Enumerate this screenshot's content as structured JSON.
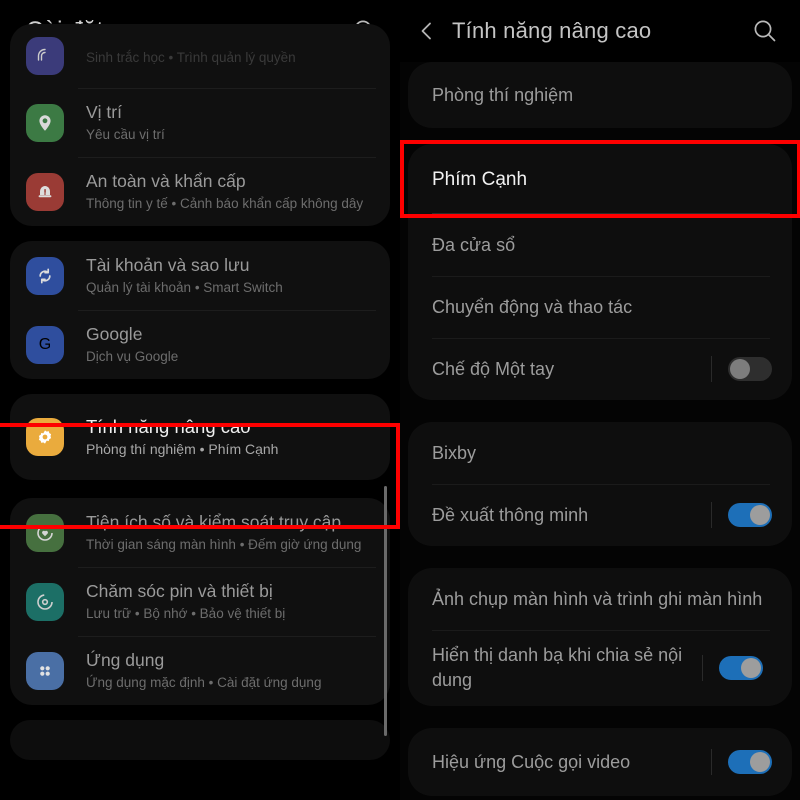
{
  "left_panel": {
    "header": {
      "title": "Cài đặt",
      "search_icon": "search-icon"
    },
    "cards": [
      {
        "rows": [
          {
            "title": "",
            "subtitle": "Sinh trắc học  •  Trình quản lý quyền",
            "icon": "fingerprint-icon",
            "icon_color": "#3b3b7a",
            "state": "faded"
          },
          {
            "title": "Vị trí",
            "subtitle": "Yêu cầu vị trí",
            "icon": "location-pin-icon",
            "icon_color": "#3c7a44",
            "state": "normal"
          },
          {
            "title": "An toàn và khẩn cấp",
            "subtitle": "Thông tin y tế  •  Cảnh báo khẩn cấp không dây",
            "icon": "emergency-alert-icon",
            "icon_color": "#9a3b35",
            "state": "normal"
          }
        ]
      },
      {
        "rows": [
          {
            "title": "Tài khoản và sao lưu",
            "subtitle": "Quản lý tài khoản  •  Smart Switch",
            "icon": "sync-accounts-icon",
            "icon_color": "#2f4e9e",
            "state": "normal"
          },
          {
            "title": "Google",
            "subtitle": "Dịch vụ Google",
            "icon": "google-g-icon",
            "icon_color": "#2f4e9e",
            "state": "normal"
          }
        ]
      },
      {
        "rows": [
          {
            "title": "Tính năng nâng cao",
            "subtitle": "Phòng thí nghiệm  •  Phím Cạnh",
            "icon": "advanced-gear-icon",
            "icon_color": "#eaab3d",
            "state": "selected"
          }
        ]
      },
      {
        "rows": [
          {
            "title": "Tiện ích số và kiểm soát truy cập",
            "subtitle": "Thời gian sáng màn hình  •  Đếm giờ ứng dụng",
            "icon": "digital-wellbeing-icon",
            "icon_color": "#46703f",
            "state": "normal"
          },
          {
            "title": "Chăm sóc pin và thiết bị",
            "subtitle": "Lưu trữ  •  Bộ nhớ  •  Bảo vệ thiết bị",
            "icon": "device-care-icon",
            "icon_color": "#1c6f66",
            "state": "normal"
          },
          {
            "title": "Ứng dụng",
            "subtitle": "Ứng dụng mặc định  •  Cài đặt ứng dụng",
            "icon": "apps-grid-icon",
            "icon_color": "#4a6fa5",
            "state": "normal"
          }
        ]
      }
    ]
  },
  "right_panel": {
    "header": {
      "back_icon": "chevron-left-icon",
      "title": "Tính năng nâng cao",
      "search_icon": "search-icon"
    },
    "groups": [
      {
        "items": [
          {
            "label": "Phòng thí nghiệm",
            "toggle": null,
            "highlighted": false
          }
        ]
      },
      {
        "items": [
          {
            "label": "Phím Cạnh",
            "toggle": null,
            "highlighted": true
          },
          {
            "label": "Đa cửa sổ",
            "toggle": null,
            "highlighted": false
          },
          {
            "label": "Chuyển động và thao tác",
            "toggle": null,
            "highlighted": false
          },
          {
            "label": "Chế độ Một tay",
            "toggle": "off",
            "highlighted": false
          }
        ]
      },
      {
        "items": [
          {
            "label": "Bixby",
            "toggle": null,
            "highlighted": false
          },
          {
            "label": "Đề xuất thông minh",
            "toggle": "on",
            "highlighted": false
          }
        ]
      },
      {
        "items": [
          {
            "label": "Ảnh chụp màn hình và trình ghi màn hình",
            "toggle": null,
            "highlighted": false
          },
          {
            "label": "Hiển thị danh bạ khi chia sẻ nội dung",
            "toggle": "on",
            "highlighted": false
          }
        ]
      },
      {
        "items": [
          {
            "label": "Hiệu ứng Cuộc gọi video",
            "toggle": "on",
            "highlighted": false
          }
        ]
      }
    ]
  },
  "annotations": {
    "highlight_color": "#fe0000",
    "boxes": [
      {
        "name": "advanced-features-highlight"
      },
      {
        "name": "edge-panel-highlight"
      }
    ]
  }
}
